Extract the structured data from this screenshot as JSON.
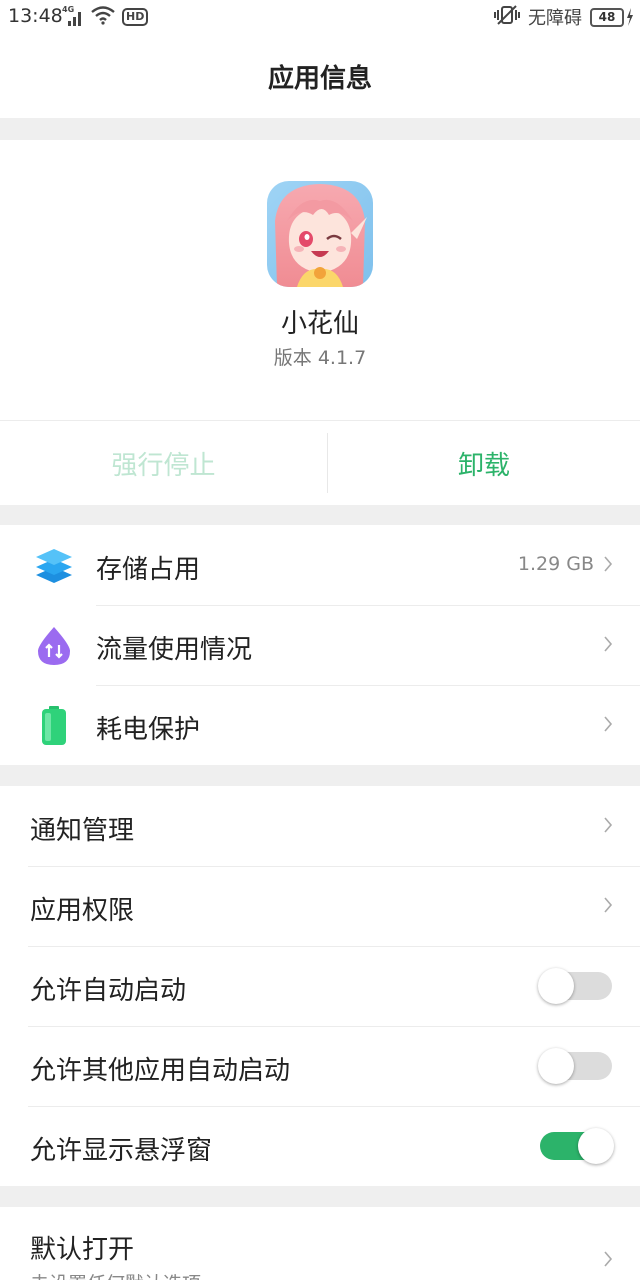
{
  "status_bar": {
    "time": "13:48",
    "network_type": "4G",
    "hd_label": "HD",
    "accessibility": "无障碍",
    "battery": "48"
  },
  "header": {
    "title": "应用信息"
  },
  "app": {
    "name": "小花仙",
    "version": "版本 4.1.7"
  },
  "actions": {
    "force_stop": "强行停止",
    "uninstall": "卸载"
  },
  "group1": [
    {
      "label": "存储占用",
      "value": "1.29 GB",
      "icon": "layers-icon",
      "color": "#2aa6f0"
    },
    {
      "label": "流量使用情况",
      "icon": "data-usage-icon",
      "color": "#9b6bf0"
    },
    {
      "label": "耗电保护",
      "icon": "battery-icon",
      "color": "#2fd27a"
    }
  ],
  "group2": [
    {
      "label": "通知管理"
    },
    {
      "label": "应用权限"
    },
    {
      "label": "允许自动启动",
      "toggle": false
    },
    {
      "label": "允许其他应用自动启动",
      "toggle": false
    },
    {
      "label": "允许显示悬浮窗",
      "toggle": true
    }
  ],
  "group3": {
    "label": "默认打开",
    "sub": "未设置任何默认选项"
  },
  "colors": {
    "accent": "#2cb36a",
    "accent_disabled": "#bfe6d2"
  }
}
